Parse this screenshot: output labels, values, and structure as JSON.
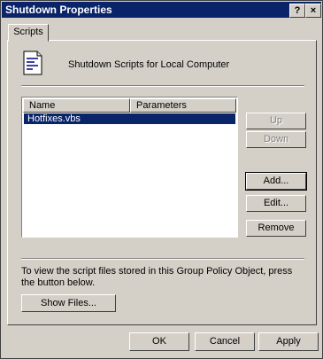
{
  "window": {
    "title": "Shutdown Properties",
    "help_label": "?",
    "close_label": "×"
  },
  "tabs": [
    {
      "label": "Scripts"
    }
  ],
  "header": {
    "text": "Shutdown Scripts for Local Computer"
  },
  "list": {
    "columns": [
      "Name",
      "Parameters"
    ],
    "rows": [
      {
        "name": "Hotfixes.vbs",
        "parameters": ""
      }
    ]
  },
  "side_buttons": {
    "up": "Up",
    "down": "Down",
    "add": "Add...",
    "edit": "Edit...",
    "remove": "Remove"
  },
  "info": {
    "text": "To view the script files stored in this Group Policy Object, press the button below."
  },
  "show_files_label": "Show Files...",
  "footer": {
    "ok": "OK",
    "cancel": "Cancel",
    "apply": "Apply"
  },
  "colors": {
    "titlebar": "#0a246a",
    "selection": "#0a246a",
    "face": "#d4d0c8"
  }
}
